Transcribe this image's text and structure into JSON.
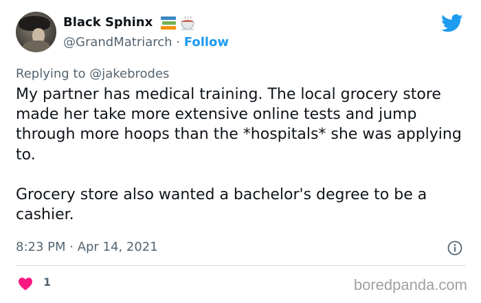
{
  "author": {
    "display_name": "Black Sphinx",
    "name_emojis": [
      "books-emoji",
      "coffee-cup-emoji"
    ],
    "handle": "@GrandMatriarch",
    "separator": "·",
    "follow_label": "Follow"
  },
  "reply": {
    "prefix": "Replying to",
    "mention": "@jakebrodes"
  },
  "tweet": {
    "paragraphs": [
      "My partner has medical training. The local grocery store made her take more extensive online tests and jump through more hoops than the *hospitals* she was applying to.",
      "Grocery store also wanted a bachelor's degree to be a cashier."
    ],
    "timestamp": "8:23 PM · Apr 14, 2021"
  },
  "engagement": {
    "likes": "1"
  },
  "watermark": "boredpanda.com",
  "icons": {
    "platform": "twitter-bird-icon",
    "info": "info-icon",
    "like": "heart-icon"
  },
  "colors": {
    "accent": "#1d9bf0",
    "heart": "#f91880",
    "muted": "#536471",
    "text": "#0f1419"
  }
}
